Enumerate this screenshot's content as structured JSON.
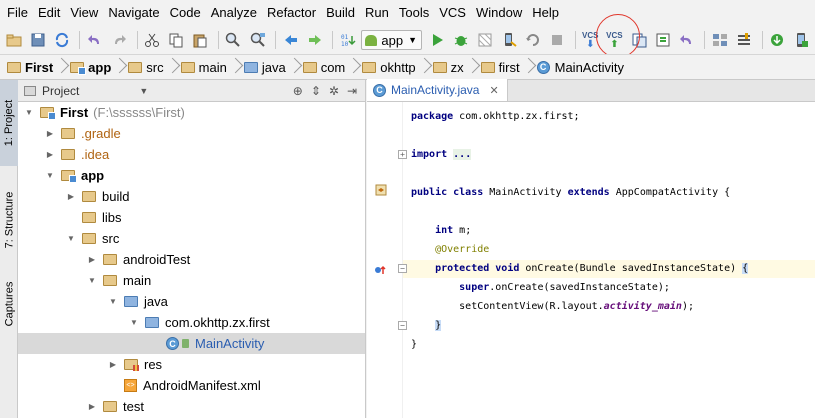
{
  "menu": [
    "File",
    "Edit",
    "View",
    "Navigate",
    "Code",
    "Analyze",
    "Refactor",
    "Build",
    "Run",
    "Tools",
    "VCS",
    "Window",
    "Help"
  ],
  "toolbar": {
    "run_config": "app",
    "vcs_label": "VCS"
  },
  "breadcrumb": [
    "First",
    "app",
    "src",
    "main",
    "java",
    "com",
    "okhttp",
    "zx",
    "first",
    "MainActivity"
  ],
  "side_tabs": {
    "project": "1: Project",
    "structure": "7: Structure",
    "captures": "Captures"
  },
  "project_panel": {
    "title": "Project",
    "tree": [
      {
        "label": "First",
        "sub": "(F:\\ssssss\\First)",
        "depth": 0,
        "expanded": true,
        "icon": "module-folder",
        "bold": true
      },
      {
        "label": ".gradle",
        "depth": 1,
        "expanded": false,
        "icon": "folder",
        "color": "orange"
      },
      {
        "label": ".idea",
        "depth": 1,
        "expanded": false,
        "icon": "folder",
        "color": "orange"
      },
      {
        "label": "app",
        "depth": 1,
        "expanded": true,
        "icon": "module-folder",
        "bold": true
      },
      {
        "label": "build",
        "depth": 2,
        "expanded": false,
        "icon": "folder"
      },
      {
        "label": "libs",
        "depth": 2,
        "expanded": null,
        "icon": "folder"
      },
      {
        "label": "src",
        "depth": 2,
        "expanded": true,
        "icon": "folder"
      },
      {
        "label": "androidTest",
        "depth": 3,
        "expanded": false,
        "icon": "folder"
      },
      {
        "label": "main",
        "depth": 3,
        "expanded": true,
        "icon": "folder"
      },
      {
        "label": "java",
        "depth": 4,
        "expanded": true,
        "icon": "source-folder"
      },
      {
        "label": "com.okhttp.zx.first",
        "depth": 5,
        "expanded": true,
        "icon": "package"
      },
      {
        "label": "MainActivity",
        "depth": 6,
        "expanded": null,
        "icon": "class",
        "selected": true,
        "color": "blue"
      },
      {
        "label": "res",
        "depth": 4,
        "expanded": false,
        "icon": "res-folder"
      },
      {
        "label": "AndroidManifest.xml",
        "depth": 4,
        "expanded": null,
        "icon": "xml"
      },
      {
        "label": "test",
        "depth": 3,
        "expanded": false,
        "icon": "folder"
      }
    ]
  },
  "editor": {
    "tab_label": "MainActivity.java",
    "lines": [
      {
        "segments": [
          {
            "t": "package ",
            "c": "kw"
          },
          {
            "t": "com.okhttp.zx.first;",
            "c": ""
          }
        ]
      },
      {
        "segments": []
      },
      {
        "segments": [
          {
            "t": "import ",
            "c": "kw"
          },
          {
            "t": "...",
            "c": "folded"
          }
        ]
      },
      {
        "segments": []
      },
      {
        "segments": [
          {
            "t": "public class ",
            "c": "kw"
          },
          {
            "t": "MainActivity ",
            "c": ""
          },
          {
            "t": "extends ",
            "c": "kw"
          },
          {
            "t": "AppCompatActivity {",
            "c": ""
          }
        ]
      },
      {
        "segments": []
      },
      {
        "segments": [
          {
            "t": "    int ",
            "c": "kw"
          },
          {
            "t": "m;",
            "c": ""
          }
        ]
      },
      {
        "segments": [
          {
            "t": "    @Override",
            "c": "ann"
          }
        ]
      },
      {
        "segments": [
          {
            "t": "    protected void ",
            "c": "kw"
          },
          {
            "t": "onCreate(Bundle savedInstanceState) ",
            "c": ""
          },
          {
            "t": "{",
            "c": "cursor-hl"
          }
        ]
      },
      {
        "segments": [
          {
            "t": "        super",
            "c": "kw"
          },
          {
            "t": ".onCreate(savedInstanceState);",
            "c": ""
          }
        ]
      },
      {
        "segments": [
          {
            "t": "        setContentView(R.layout.",
            "c": ""
          },
          {
            "t": "activity_main",
            "c": "fld"
          },
          {
            "t": ");",
            "c": ""
          }
        ]
      },
      {
        "segments": [
          {
            "t": "    ",
            "c": ""
          },
          {
            "t": "}",
            "c": "cursor-hl"
          }
        ]
      },
      {
        "segments": [
          {
            "t": "}",
            "c": ""
          }
        ]
      }
    ]
  }
}
